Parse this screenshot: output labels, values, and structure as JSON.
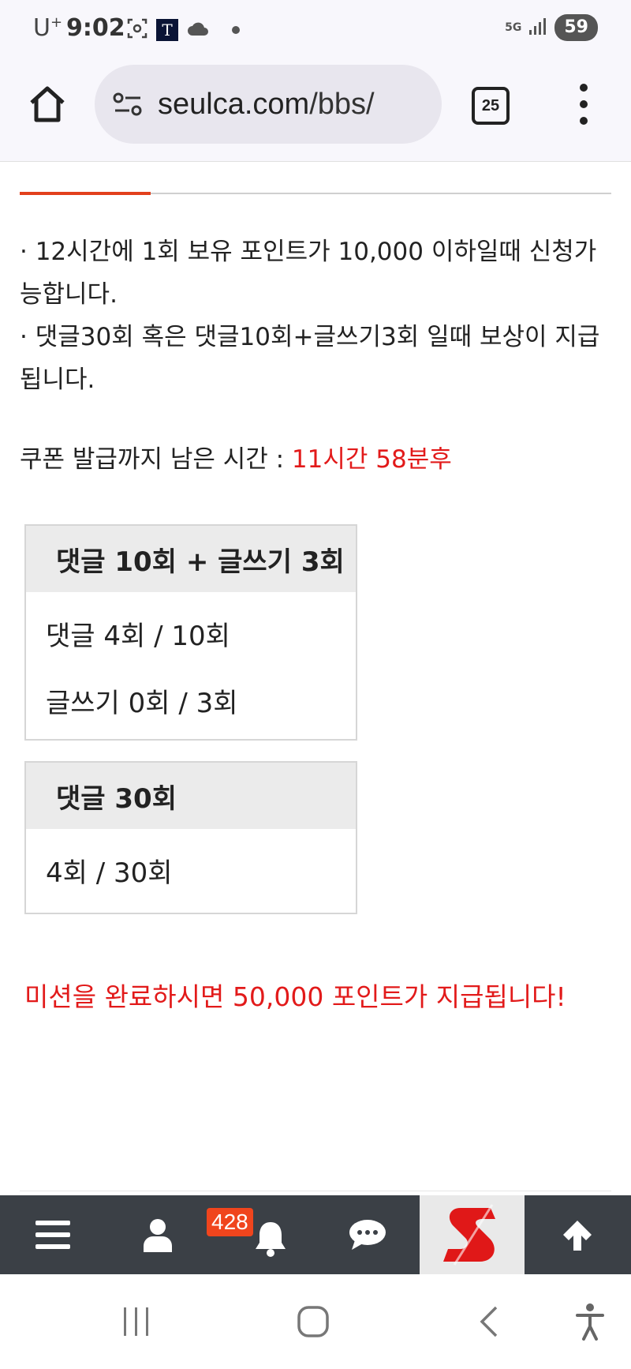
{
  "status_bar": {
    "carrier": "U",
    "carrier_sup": "+",
    "time": "9:02",
    "network": "5G",
    "battery": "59"
  },
  "browser": {
    "url_domain": "seulca.com",
    "url_path": "/bbs/",
    "tab_count": "25"
  },
  "content": {
    "desc_line1": "· 12시간에 1회 보유 포인트가 10,000 이하일때 신청가능합니다.",
    "desc_line2": "· 댓글30회 혹은 댓글10회+글쓰기3회 일때 보상이 지급됩니다.",
    "coupon_label": "쿠폰 발급까지 남은 시간 : ",
    "coupon_remaining": "11시간 58분후",
    "mission1": {
      "title": "댓글 10회 + 글쓰기 3회",
      "row1": "댓글 4회 / 10회",
      "row2": "글쓰기 0회 / 3회"
    },
    "mission2": {
      "title": "댓글 30회",
      "row1": "4회 / 30회"
    },
    "reward_text": "미션을 완료하시면 50,000 포인트가 지급됩니다!"
  },
  "site_nav": {
    "notification_count": "428",
    "items": [
      "menu-icon",
      "user-icon",
      "bell-icon",
      "chat-icon",
      "site-logo",
      "arrow-up-icon"
    ]
  },
  "colors": {
    "accent": "#e2401c",
    "red_text": "#e21a1a",
    "nav_bg": "#3b4046",
    "badge": "#f0451d"
  }
}
